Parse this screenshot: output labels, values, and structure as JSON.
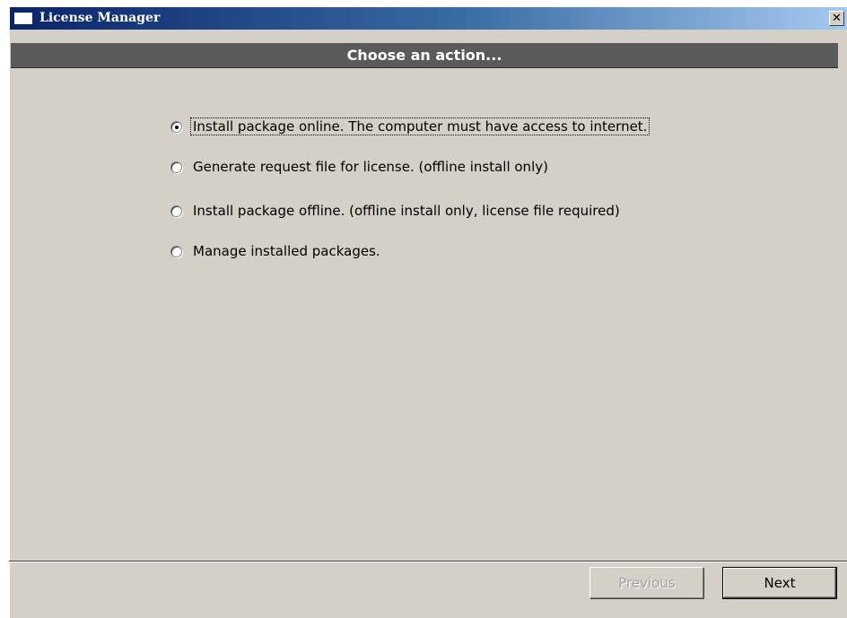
{
  "window": {
    "title": "License Manager",
    "close_glyph": "✕"
  },
  "banner": {
    "text": "Choose an action..."
  },
  "options": [
    {
      "label": "Install package online. The computer must have access to internet.",
      "checked": true
    },
    {
      "label": "Generate request file for license. (offline install only)",
      "checked": false
    },
    {
      "label": "Install package offline. (offline install only, license file required)",
      "checked": false
    },
    {
      "label": "Manage installed packages.",
      "checked": false
    }
  ],
  "buttons": {
    "previous": "Previous",
    "next": "Next"
  },
  "colors": {
    "titlebar_start": "#0a246a",
    "titlebar_end": "#a6caf0",
    "window_face": "#d4d0c8",
    "banner": "#5a5a5a"
  }
}
